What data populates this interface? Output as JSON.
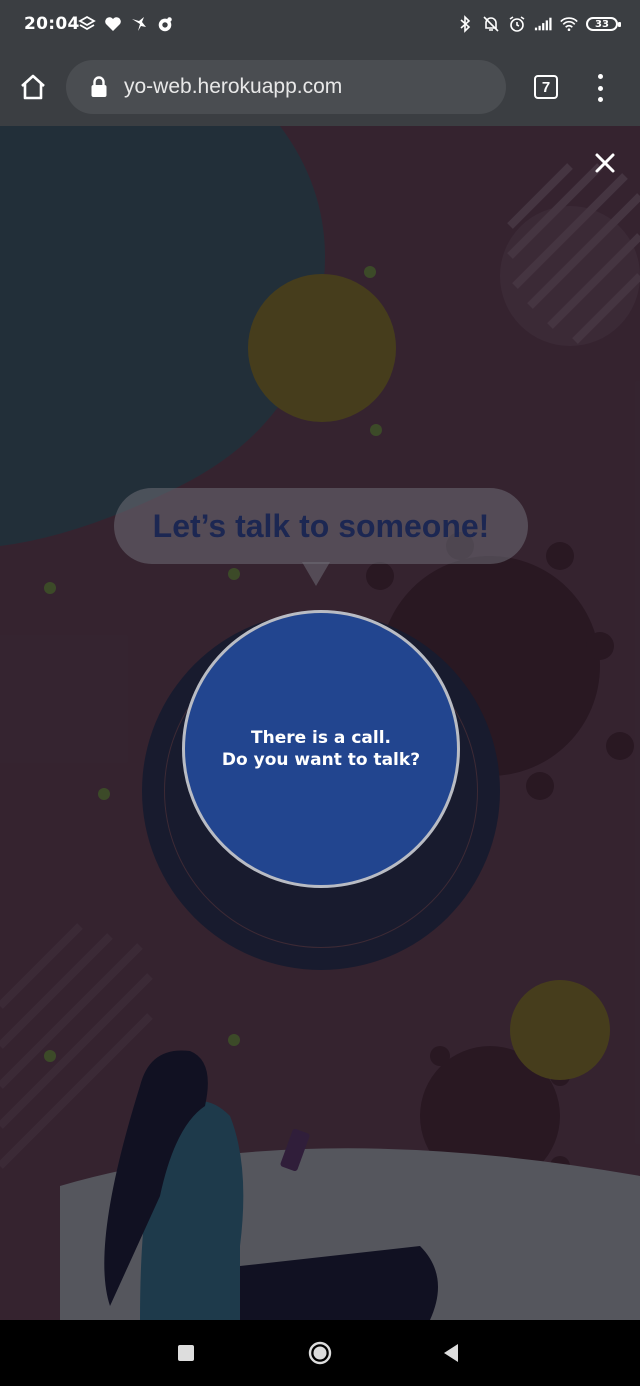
{
  "status_bar": {
    "time": "20:04",
    "left_icons": [
      "layers-icon",
      "heart-icon",
      "bird-icon",
      "cloud-app-icon"
    ],
    "right_icons": [
      "bluetooth-icon",
      "muted-bell-icon",
      "alarm-icon",
      "signal-icon",
      "wifi-icon"
    ],
    "battery": "33"
  },
  "browser": {
    "url": "yo-web.herokuapp.com",
    "tab_count": "7"
  },
  "page": {
    "headline": "Let’s talk to someone!",
    "call_line1": "There is a call.",
    "call_line2": "Do you want to talk?"
  },
  "colors": {
    "call_button": "#22458f",
    "headline": "#1c2752",
    "chrome": "#3b3e42"
  }
}
